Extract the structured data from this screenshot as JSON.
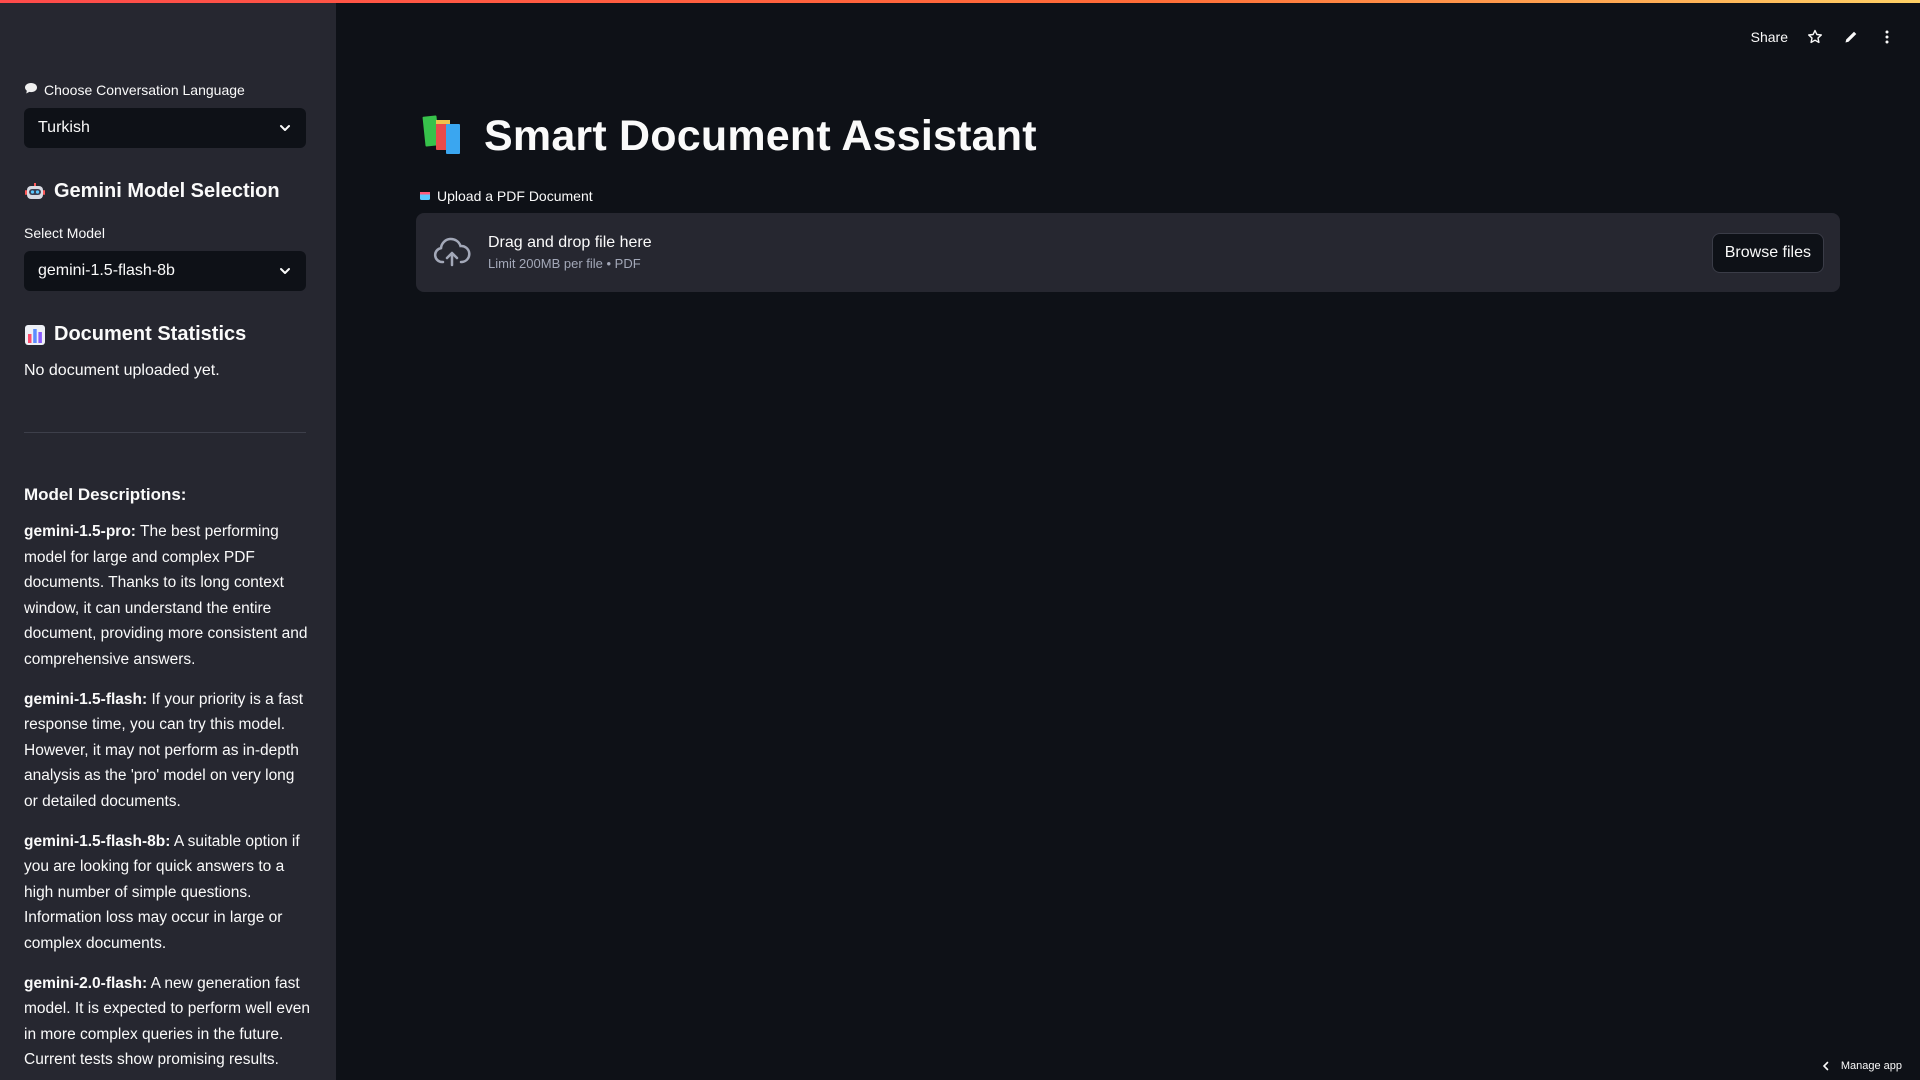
{
  "sidebar": {
    "language_label": "Choose Conversation Language",
    "language_value": "Turkish",
    "model_heading": "Gemini Model Selection",
    "select_model_label": "Select Model",
    "model_value": "gemini-1.5-flash-8b",
    "stats_heading": "Document Statistics",
    "stats_text": "No document uploaded yet.",
    "descriptions_title": "Model Descriptions:",
    "descriptions": [
      {
        "name": "gemini-1.5-pro:",
        "text": " The best performing model for large and complex PDF documents. Thanks to its long context window, it can understand the entire document, providing more consistent and comprehensive answers."
      },
      {
        "name": "gemini-1.5-flash:",
        "text": " If your priority is a fast response time, you can try this model. However, it may not perform as in-depth analysis as the 'pro' model on very long or detailed documents."
      },
      {
        "name": "gemini-1.5-flash-8b:",
        "text": " A suitable option if you are looking for quick answers to a high number of simple questions. Information loss may occur in large or complex documents."
      },
      {
        "name": "gemini-2.0-flash:",
        "text": " A new generation fast model. It is expected to perform well even in more complex queries in the future. Current tests show promising results."
      }
    ]
  },
  "header": {
    "share_label": "Share"
  },
  "main": {
    "title": "Smart Document Assistant",
    "upload_label": "Upload a PDF Document",
    "dropzone_text": "Drag and drop file here",
    "dropzone_limit": "Limit 200MB per file • PDF",
    "browse_label": "Browse files"
  },
  "footer": {
    "manage_app_label": "Manage app"
  },
  "colors": {
    "background": "#0e1117",
    "sidebar": "#262730",
    "accent": "#ff4b4b"
  }
}
